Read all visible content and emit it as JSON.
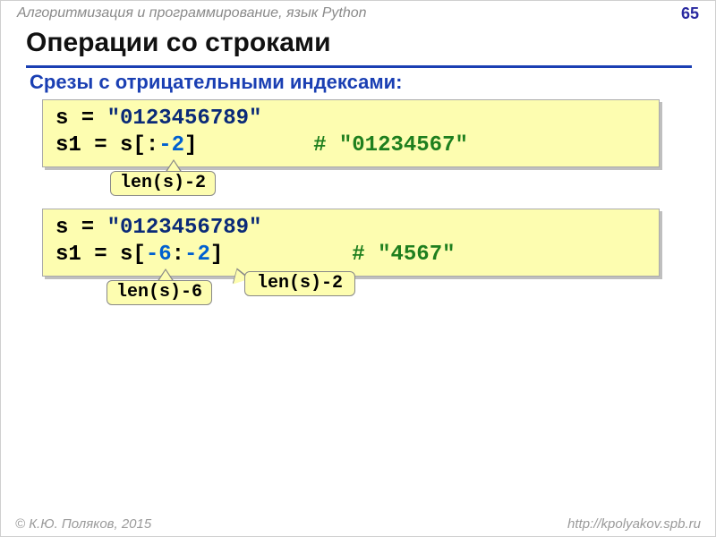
{
  "header": {
    "course": "Алгоритмизация и программирование, язык Python",
    "page_number": "65"
  },
  "title": "Операции со строками",
  "subtitle": "Срезы с отрицательными индексами:",
  "code1": {
    "line1_a": "s = ",
    "line1_b": "\"0123456789\"",
    "line2_a": "s1 = s[:",
    "line2_b": "-2",
    "line2_c": "]",
    "comment": "# \"01234567\""
  },
  "tag1": "len(s)-2",
  "code2": {
    "line1_a": "s = ",
    "line1_b": "\"0123456789\"",
    "line2_a": "s1 = s[",
    "line2_b": "-6",
    "line2_c": ":",
    "line2_d": "-2",
    "line2_e": "]",
    "comment": "# \"4567\""
  },
  "tag2a": "len(s)-6",
  "tag2b": "len(s)-2",
  "footer": {
    "copyright": "© К.Ю. Поляков, 2015",
    "url": "http://kpolyakov.spb.ru"
  }
}
